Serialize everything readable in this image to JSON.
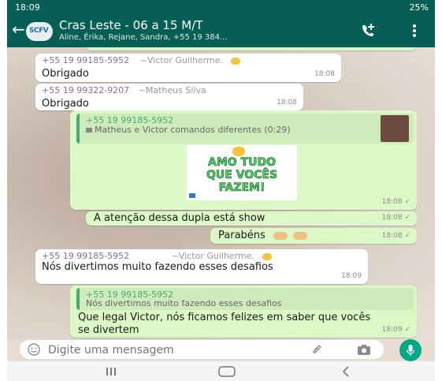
{
  "status_bar": {
    "time": "18:09",
    "right_text": "25%"
  },
  "header": {
    "title": "Cras Leste - 06 a 15 M/T",
    "subtitle": "Aline, Érika, Rejane, Sandra, +55 19 384...",
    "avatar_text": "SCFV"
  },
  "messages": [
    {
      "sender": "+55 19 99185-5952",
      "alias": "~Victor Guilherme.",
      "text": "Obrigado",
      "time": "18:08"
    },
    {
      "sender": "+55 19 99322-9207",
      "alias": "~Matheus Silva",
      "text": "Obrigado",
      "time": "18:08"
    },
    {
      "quote_sender": "+55 19 99185-5952",
      "quote_text": "Matheus e Victor comandos diferentes (0:29)",
      "sticker_lines": [
        "AMO TUDO",
        "QUE VOCÊS",
        "FAZEM!"
      ],
      "time": "18:08"
    },
    {
      "text": "A atenção dessa dupla está show",
      "time": "18:08"
    },
    {
      "text": "Parabéns",
      "time": "18:08"
    },
    {
      "sender": "+55 19 99185-5952",
      "alias": "~Victor Guilherme.",
      "text": "Nós divertimos muito fazendo esses desafios",
      "time": "18:09"
    },
    {
      "quote_sender": "+55 19 99185-5952",
      "quote_text": "Nós divertimos muito fazendo esses desafios",
      "text": "Que legal Victor, nós ficamos felizes em saber que vocês se divertem",
      "time": "18:09"
    }
  ],
  "input": {
    "placeholder": "Digite uma mensagem"
  },
  "colors": {
    "header": "#075e54",
    "outgoing": "#dcf8c6",
    "incoming": "#ffffff",
    "accent": "#00a884"
  },
  "icons": [
    "back-arrow-icon",
    "add-call-icon",
    "more-vert-icon",
    "emoji-icon",
    "attach-icon",
    "camera-icon",
    "mic-icon",
    "nav-recents-icon",
    "nav-home-icon",
    "nav-back-icon"
  ]
}
